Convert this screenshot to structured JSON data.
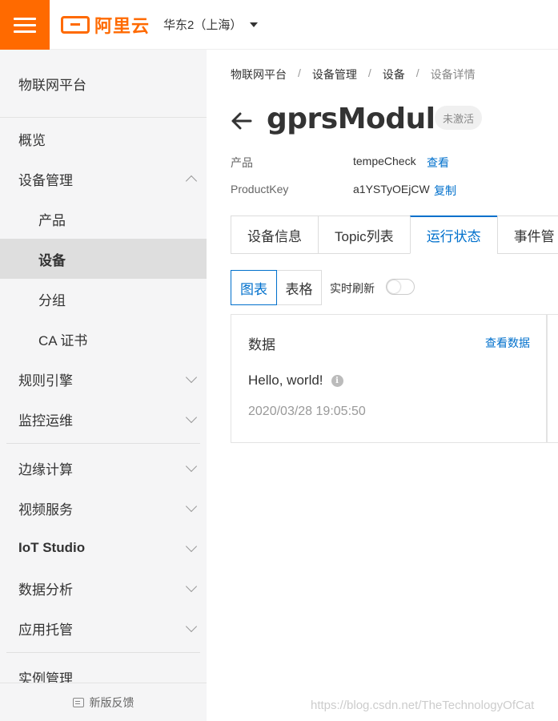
{
  "header": {
    "logo_text": "阿里云",
    "region": "华东2（上海）"
  },
  "sidebar": {
    "title": "物联网平台",
    "items": [
      {
        "label": "概览"
      },
      {
        "label": "设备管理"
      },
      {
        "label": "产品"
      },
      {
        "label": "设备"
      },
      {
        "label": "分组"
      },
      {
        "label": "CA 证书"
      },
      {
        "label": "规则引擎"
      },
      {
        "label": "监控运维"
      },
      {
        "label": "边缘计算"
      },
      {
        "label": "视频服务"
      },
      {
        "label": "IoT Studio"
      },
      {
        "label": "数据分析"
      },
      {
        "label": "应用托管"
      },
      {
        "label": "实例管理"
      }
    ],
    "feedback": "新版反馈"
  },
  "breadcrumb": [
    "物联网平台",
    "设备管理",
    "设备",
    "设备详情"
  ],
  "breadcrumb_sep": "/",
  "device": {
    "name": "gprsModule",
    "status": "未激活",
    "product_label": "产品",
    "product_value": "tempeCheck",
    "product_link": "查看",
    "key_label": "ProductKey",
    "key_value": "a1YSTyOEjCW",
    "key_link": "复制"
  },
  "tabs": [
    "设备信息",
    "Topic列表",
    "运行状态",
    "事件管"
  ],
  "view": {
    "chart": "图表",
    "table": "表格",
    "refresh_label": "实时刷新",
    "refresh_on": false
  },
  "card": {
    "title": "数据",
    "link": "查看数据",
    "value": "Hello, world!",
    "info_icon": "i",
    "time": "2020/03/28 19:05:50"
  },
  "watermark": "https://blog.csdn.net/TheTechnologyOfCat",
  "colors": {
    "brand": "#ff6a00",
    "accent": "#0070cc"
  }
}
